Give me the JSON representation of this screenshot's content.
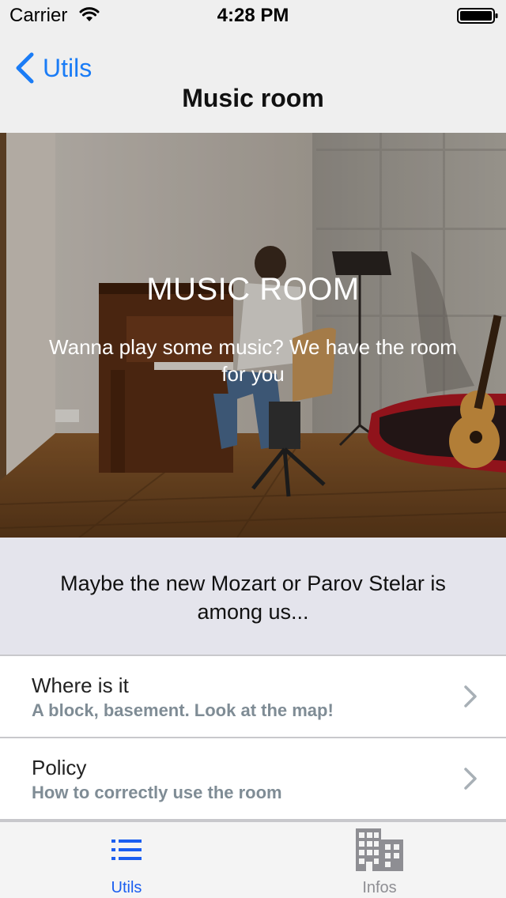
{
  "status_bar": {
    "carrier": "Carrier",
    "time": "4:28 PM",
    "wifi_icon": "wifi-icon",
    "battery_icon": "battery-icon"
  },
  "nav_bar": {
    "back_label": "Utils",
    "back_icon": "chevron-left-icon",
    "title": "Music room"
  },
  "hero": {
    "title": "MUSIC ROOM",
    "subtitle": "Wanna play some music? We have the room for you"
  },
  "tagline": "Maybe the new Mozart or Parov Stelar is among us...",
  "list": {
    "items": [
      {
        "title": "Where is it",
        "subtitle": "A block, basement. Look at the map!",
        "icon": "chevron-right-icon"
      },
      {
        "title": "Policy",
        "subtitle": "How to correctly use the room",
        "icon": "chevron-right-icon"
      }
    ]
  },
  "tab_bar": {
    "tabs": [
      {
        "label": "Utils",
        "icon": "list-icon",
        "selected": true
      },
      {
        "label": "Infos",
        "icon": "building-icon",
        "selected": false
      }
    ]
  },
  "colors": {
    "accent": "#1a7cf6",
    "tab_selected": "#1a5ef0",
    "tab_unselected": "#8e8e93",
    "subtitle_gray": "#7f8c95"
  }
}
